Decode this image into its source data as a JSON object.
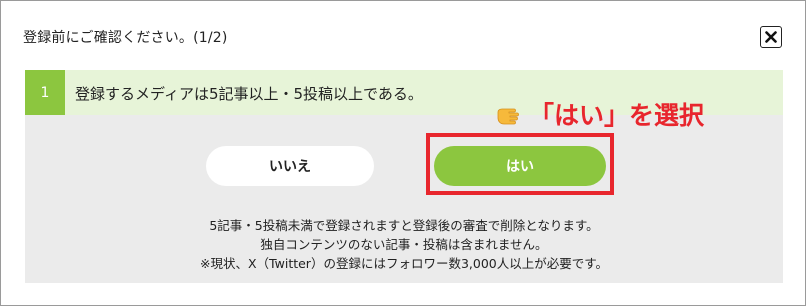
{
  "dialog": {
    "title": "登録前にご確認ください。(1/2)",
    "close_icon": "close-icon"
  },
  "question": {
    "number": "1",
    "text": "登録するメディアは5記事以上・5投稿以上である。"
  },
  "annotation": {
    "icon": "pointing-hand-icon",
    "text": "「はい」を選択",
    "color": "#e8262d"
  },
  "buttons": {
    "no_label": "いいえ",
    "yes_label": "はい"
  },
  "notes": {
    "line1": "5記事・5投稿未満で登録されますと登録後の審査で削除となります。",
    "line2": "独自コンテンツのない記事・投稿は含まれません。",
    "line3": "※現状、X（Twitter）の登録にはフォロワー数3,000人以上が必要です。"
  },
  "colors": {
    "accent": "#8cc63f",
    "question_bg": "#e7f4d8",
    "panel_bg": "#ebebeb"
  }
}
